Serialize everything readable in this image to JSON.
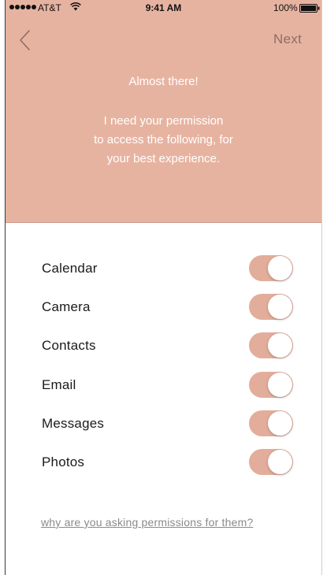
{
  "status_bar": {
    "carrier": "AT&T",
    "time": "9:41 AM",
    "battery": "100%"
  },
  "nav": {
    "back_icon": "chevron-left-icon",
    "next_label": "Next"
  },
  "header": {
    "title": "Almost there!",
    "message_lines": [
      "I need your permission",
      "to access the following, for",
      "your best experience."
    ]
  },
  "permissions": [
    {
      "label": "Calendar",
      "enabled": true
    },
    {
      "label": "Camera",
      "enabled": true
    },
    {
      "label": "Contacts",
      "enabled": true
    },
    {
      "label": "Email",
      "enabled": true
    },
    {
      "label": "Messages",
      "enabled": true
    },
    {
      "label": "Photos",
      "enabled": true
    }
  ],
  "why_link": "why are you asking permissions for them?",
  "colors": {
    "header_bg": "#e7b3a1",
    "toggle_on": "#e3ad9b",
    "next_text": "#8b6e66",
    "link_text": "#8a8a8a"
  }
}
